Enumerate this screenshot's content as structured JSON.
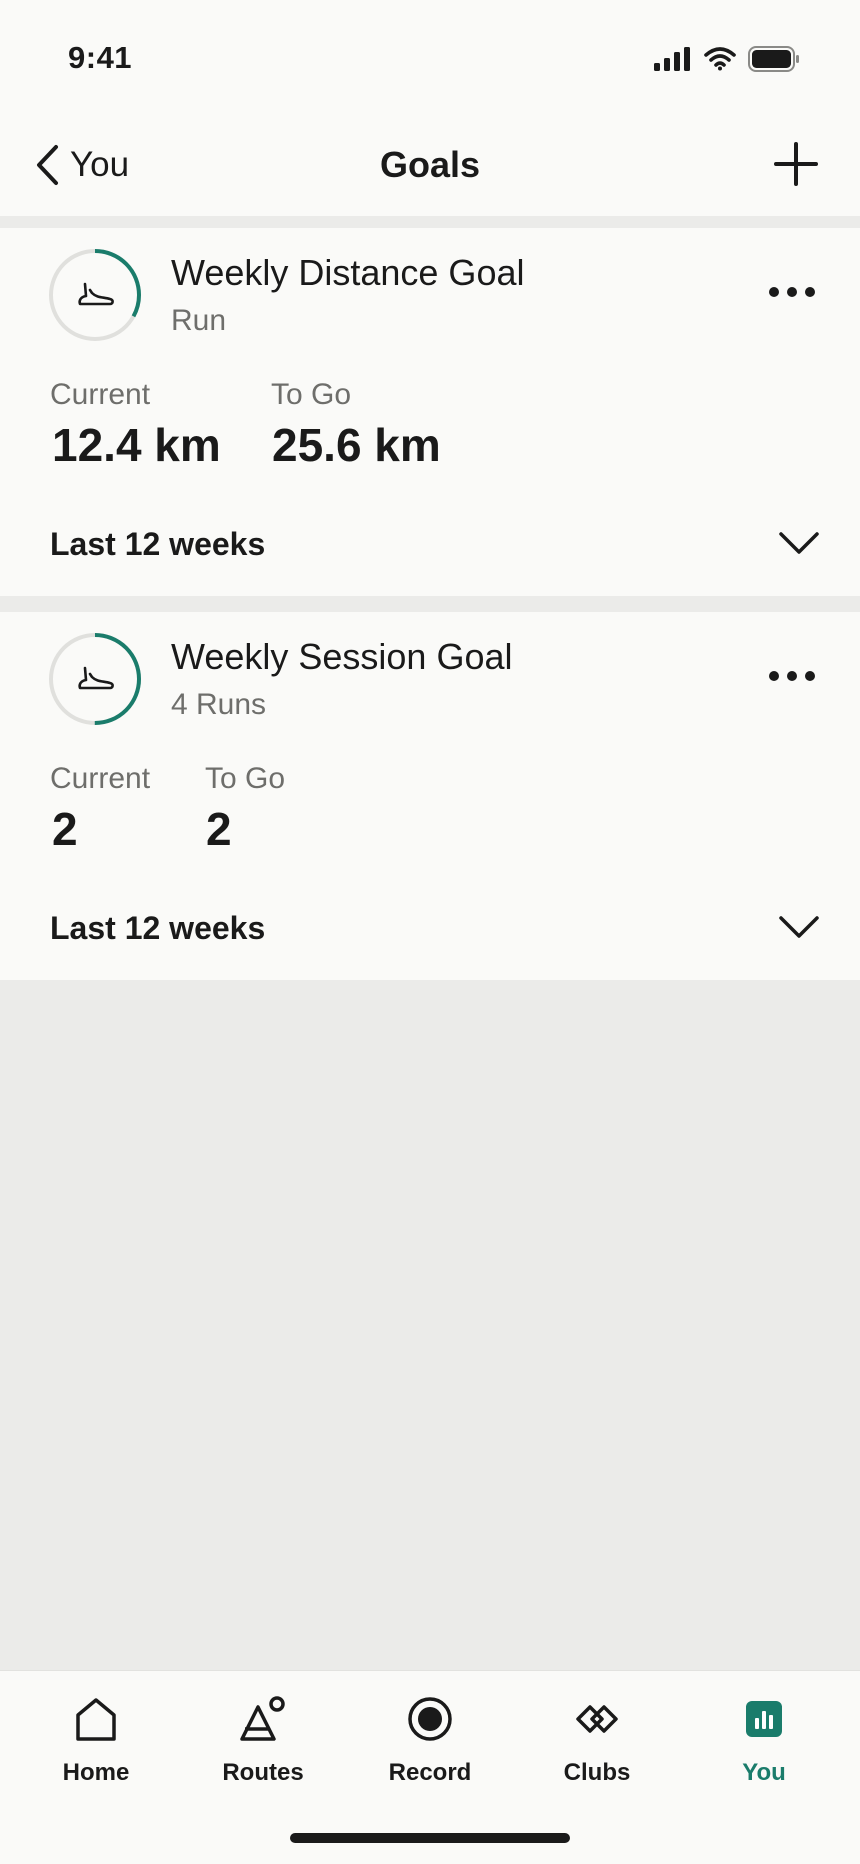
{
  "status": {
    "time": "9:41"
  },
  "nav": {
    "back_label": "You",
    "title": "Goals"
  },
  "goals": [
    {
      "title": "Weekly Distance Goal",
      "subtitle": "Run",
      "progress": 0.33,
      "stats": [
        {
          "label": "Current",
          "value": "12.4 km"
        },
        {
          "label": "To Go",
          "value": "25.6 km"
        }
      ],
      "period": "Last 12 weeks"
    },
    {
      "title": "Weekly Session Goal",
      "subtitle": "4 Runs",
      "progress": 0.5,
      "stats": [
        {
          "label": "Current",
          "value": "2"
        },
        {
          "label": "To Go",
          "value": "2"
        }
      ],
      "period": "Last 12 weeks"
    }
  ],
  "tabs": [
    {
      "label": "Home",
      "icon": "home-icon"
    },
    {
      "label": "Routes",
      "icon": "routes-icon"
    },
    {
      "label": "Record",
      "icon": "record-icon"
    },
    {
      "label": "Clubs",
      "icon": "clubs-icon"
    },
    {
      "label": "You",
      "icon": "you-icon",
      "active": true
    }
  ],
  "colors": {
    "accent": "#1a7c6b",
    "ring_track": "#e0e0dd",
    "card_bg": "#fafaf8",
    "page_bg": "#ebebe9"
  }
}
